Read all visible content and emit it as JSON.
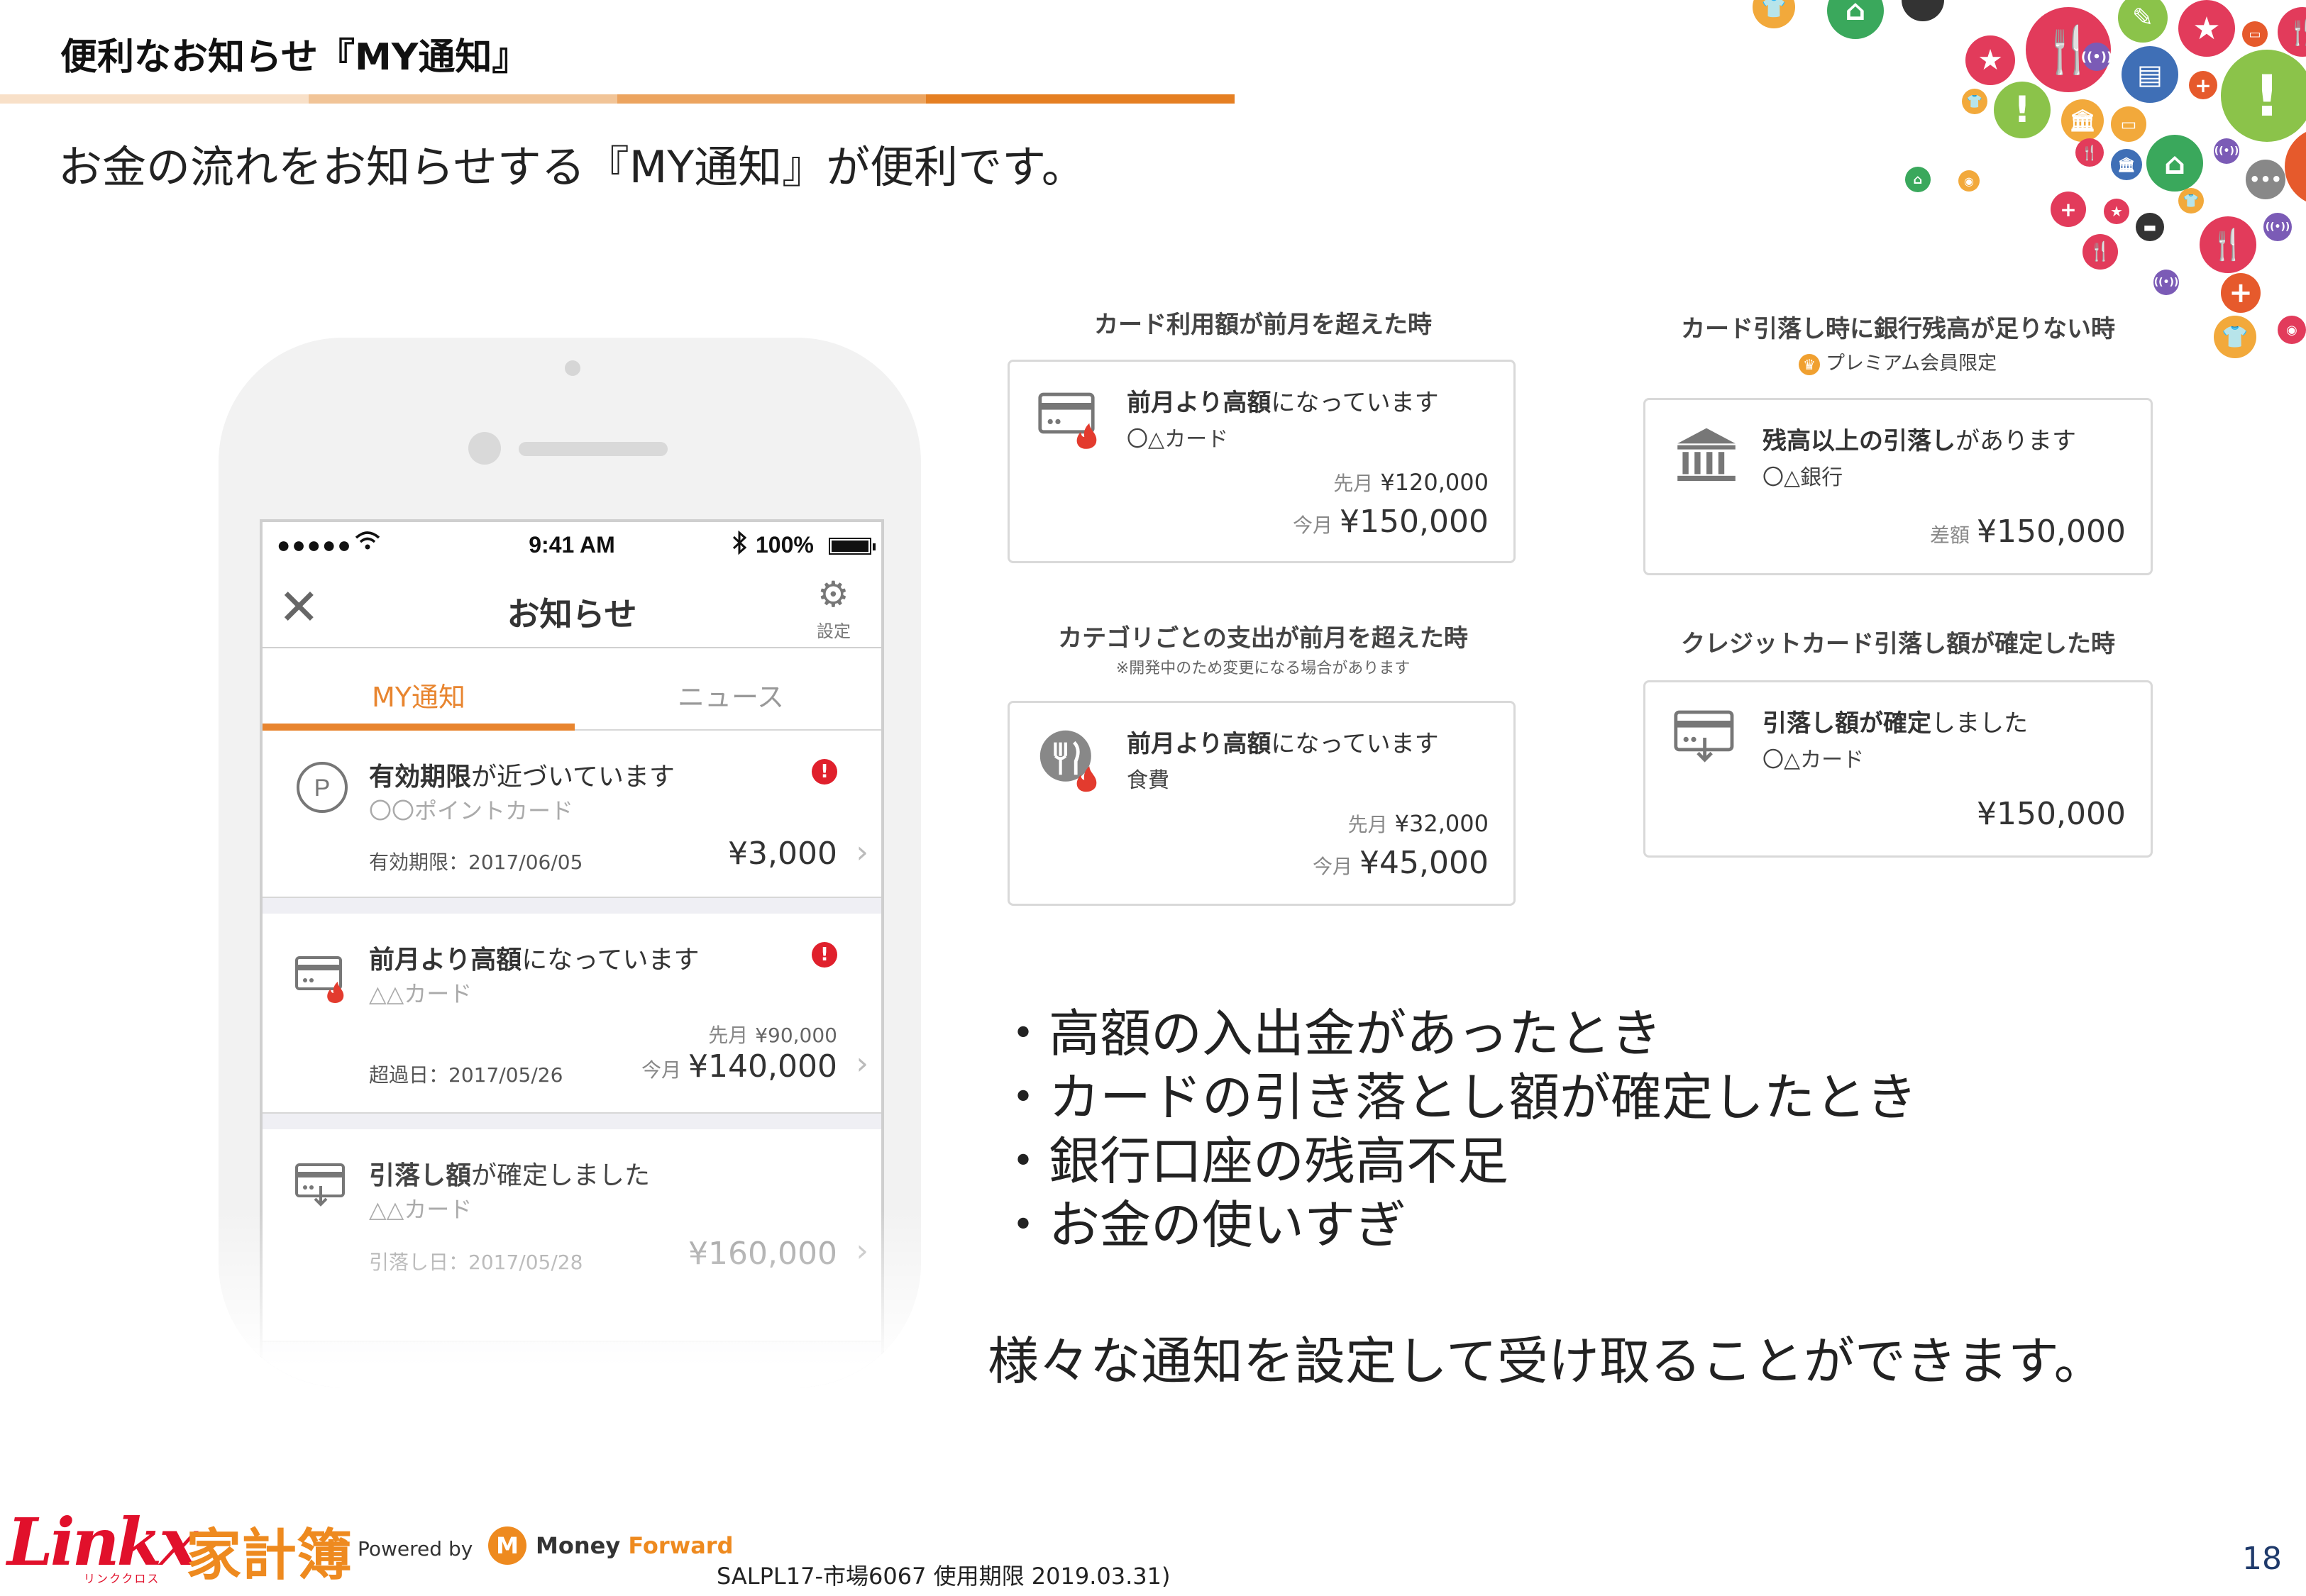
{
  "header": {
    "title": "便利なお知らせ『MY通知』",
    "lead": "お金の流れをお知らせする『MY通知』が便利です。",
    "rule_colors": [
      "#f8e0c8",
      "#f1c497",
      "#eca45f",
      "#e57f22"
    ]
  },
  "phone": {
    "status": {
      "signal": "●●●●●",
      "time": "9:41 AM",
      "battery": "100%"
    },
    "nav": {
      "title": "お知らせ",
      "settings_label": "設定"
    },
    "tabs": {
      "my": "MY通知",
      "news": "ニュース"
    },
    "notices": [
      {
        "title_bold": "有効期限",
        "title_rest": "が近づいています",
        "subtitle": "〇〇ポイントカード",
        "date": "有効期限：2017/06/05",
        "amount": "¥3,000",
        "icon": "point-card-icon",
        "badge": "!"
      },
      {
        "title_bold": "前月より高額",
        "title_rest": "になっています",
        "subtitle": "△△カード",
        "date": "超過日：2017/05/26",
        "prev_label": "先月",
        "prev_amount": "¥90,000",
        "current_label": "今月",
        "amount": "¥140,000",
        "icon": "credit-card-fire-icon",
        "badge": "!"
      },
      {
        "title_bold": "引落し額",
        "title_rest": "が確定しました",
        "subtitle": "△△カード",
        "date": "引落し日：2017/05/28",
        "amount": "¥160,000",
        "icon": "card-withdraw-icon"
      }
    ]
  },
  "panels": [
    {
      "heading": "カード利用額が前月を超えた時",
      "title_bold": "前月より高額",
      "title_rest": "になっています",
      "subtitle": "〇△カード",
      "prev_label": "先月",
      "prev_amount": "¥120,000",
      "current_label": "今月",
      "current_amount": "¥150,000",
      "icon": "credit-card-fire-icon"
    },
    {
      "heading": "カード引落し時に銀行残高が足りない時",
      "premium": "プレミアム会員限定",
      "title_bold": "残高以上の引落し",
      "title_rest": "があります",
      "subtitle": "〇△銀行",
      "current_label": "差額",
      "current_amount": "¥150,000",
      "icon": "bank-icon"
    },
    {
      "heading": "カテゴリごとの支出が前月を超えた時",
      "note": "※開発中のため変更になる場合があります",
      "title_bold": "前月より高額",
      "title_rest": "になっています",
      "subtitle": "食費",
      "prev_label": "先月",
      "prev_amount": "¥32,000",
      "current_label": "今月",
      "current_amount": "¥45,000",
      "icon": "food-fire-icon"
    },
    {
      "heading": "クレジットカード引落し額が確定した時",
      "title_bold": "引落し額が確定",
      "title_rest": "しました",
      "subtitle": "〇△カード",
      "current_amount": "¥150,000",
      "icon": "card-withdraw-icon"
    }
  ],
  "bullets": [
    "・高額の入出金があったとき",
    "・カードの引き落とし額が確定したとき",
    "・銀行口座の残高不足",
    "・お金の使いすぎ"
  ],
  "closing": "様々な通知を設定して受け取ることができます。",
  "footer": {
    "brand": "Linkx",
    "brand_kana": "リンククロス",
    "product": "家計簿",
    "powered_by": "Powered by",
    "partner_part1": "Money",
    "partner_part2": "Forward",
    "doc_code": "SALPL17-市場6067 使用期限 2019.03.31)",
    "page_number": "18"
  },
  "colors": {
    "accent_orange": "#e8852f",
    "alert_red": "#e0202c",
    "brand_red": "#e1102b"
  }
}
